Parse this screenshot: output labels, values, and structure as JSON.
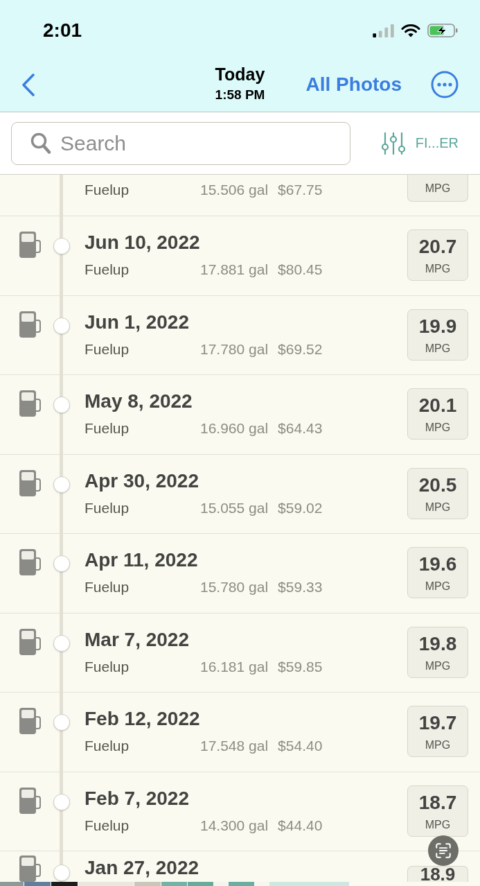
{
  "status_bar": {
    "time": "2:01"
  },
  "nav": {
    "title": "Today",
    "subtitle": "1:58 PM",
    "action": "All Photos"
  },
  "search": {
    "placeholder": "Search"
  },
  "filter": {
    "label": "FI...ER"
  },
  "entries": [
    {
      "kind": "cut_top",
      "type": "Fuelup",
      "gallons": "15.506 gal",
      "cost": "$67.75",
      "unit": "MPG"
    },
    {
      "kind": "full",
      "date": "Jun 10, 2022",
      "type": "Fuelup",
      "gallons": "17.881 gal",
      "cost": "$80.45",
      "mpg": "20.7",
      "unit": "MPG"
    },
    {
      "kind": "full",
      "date": "Jun 1, 2022",
      "type": "Fuelup",
      "gallons": "17.780 gal",
      "cost": "$69.52",
      "mpg": "19.9",
      "unit": "MPG"
    },
    {
      "kind": "full",
      "date": "May 8, 2022",
      "type": "Fuelup",
      "gallons": "16.960 gal",
      "cost": "$64.43",
      "mpg": "20.1",
      "unit": "MPG"
    },
    {
      "kind": "full",
      "date": "Apr 30, 2022",
      "type": "Fuelup",
      "gallons": "15.055 gal",
      "cost": "$59.02",
      "mpg": "20.5",
      "unit": "MPG"
    },
    {
      "kind": "full",
      "date": "Apr 11, 2022",
      "type": "Fuelup",
      "gallons": "15.780 gal",
      "cost": "$59.33",
      "mpg": "19.6",
      "unit": "MPG"
    },
    {
      "kind": "full",
      "date": "Mar 7, 2022",
      "type": "Fuelup",
      "gallons": "16.181 gal",
      "cost": "$59.85",
      "mpg": "19.8",
      "unit": "MPG"
    },
    {
      "kind": "full",
      "date": "Feb 12, 2022",
      "type": "Fuelup",
      "gallons": "17.548 gal",
      "cost": "$54.40",
      "mpg": "19.7",
      "unit": "MPG"
    },
    {
      "kind": "full",
      "date": "Feb 7, 2022",
      "type": "Fuelup",
      "gallons": "14.300 gal",
      "cost": "$44.40",
      "mpg": "18.7",
      "unit": "MPG"
    },
    {
      "kind": "cut_bottom",
      "date": "Jan 27, 2022",
      "mpg": "18.9"
    }
  ]
}
